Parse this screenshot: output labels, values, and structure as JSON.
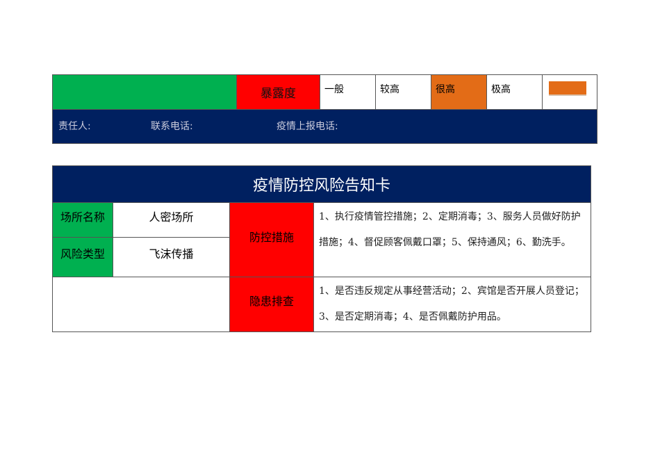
{
  "top": {
    "exposure_label": "暴露度",
    "levels": [
      "一般",
      "较高",
      "很高",
      "极高"
    ],
    "responsible_label": "责任人:",
    "contact_label": "联系电话:",
    "report_label": "疫情上报电话:"
  },
  "card": {
    "title": "疫情防控风险告知卡",
    "place_label": "场所名称",
    "place_value": "人密场所",
    "risk_label": "风险类型",
    "risk_value": "飞沫传播",
    "measures_label": "防控措施",
    "measures_text": "1、执行疫情管控措施；2、定期消毒；3、服务人员做好防护措施；4、督促顾客佩戴口罩；5、保持通风；6、勤洗手。",
    "check_label": "隐患排查",
    "check_text": "1、是否违反规定从事经营活动；2、宾馆是否开展人员登记；3、是否定期消毒；4、是否佩戴防护用品。"
  },
  "colors": {
    "green": "#00b050",
    "red": "#ff0000",
    "orange": "#e36c17",
    "navy": "#002060"
  }
}
